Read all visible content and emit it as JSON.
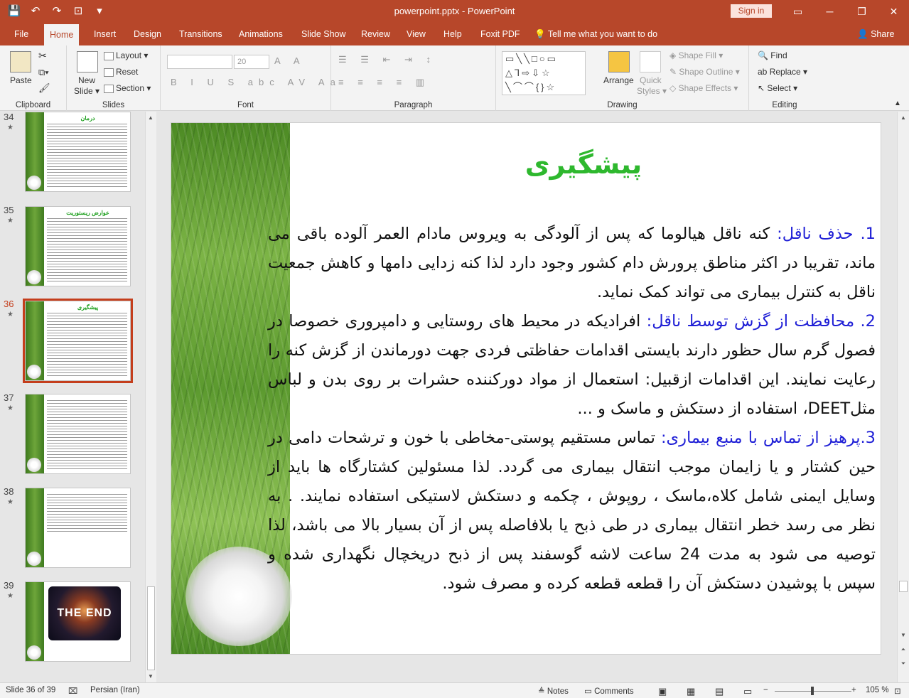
{
  "window": {
    "title": "powerpoint.pptx  -  PowerPoint",
    "signin": "Sign in",
    "minimize": "─",
    "restore": "❐",
    "close": "✕"
  },
  "qat": {
    "save": "💾",
    "undo": "↶",
    "redo": "↷",
    "present": "⊡",
    "more": "▾"
  },
  "tabs": [
    "File",
    "Home",
    "Insert",
    "Design",
    "Transitions",
    "Animations",
    "Slide Show",
    "Review",
    "View",
    "Help",
    "Foxit PDF"
  ],
  "tellme": "Tell me what you want to do",
  "share": "Share",
  "ribbon": {
    "clipboard": {
      "label": "Clipboard",
      "paste": "Paste"
    },
    "slides": {
      "label": "Slides",
      "new_slide_1": "New",
      "new_slide_2": "Slide ▾",
      "layout": "Layout ▾",
      "reset": "Reset",
      "section": "Section ▾"
    },
    "font": {
      "label": "Font",
      "size": "20",
      "styles": "B I U S abc AV Aa"
    },
    "paragraph": {
      "label": "Paragraph"
    },
    "drawing": {
      "label": "Drawing",
      "arrange": "Arrange",
      "quick_1": "Quick",
      "quick_2": "Styles ▾",
      "shape_fill": "Shape Fill ▾",
      "shape_outline": "Shape Outline ▾",
      "shape_effects": "Shape Effects ▾"
    },
    "editing": {
      "label": "Editing",
      "find": "Find",
      "replace": "Replace ▾",
      "select": "Select ▾"
    }
  },
  "thumbnails": [
    {
      "num": "34",
      "title": "درمان"
    },
    {
      "num": "35",
      "title": "عوارض ریستوریت"
    },
    {
      "num": "36",
      "title": "پیشگیری"
    },
    {
      "num": "37",
      "title": ""
    },
    {
      "num": "38",
      "title": ""
    },
    {
      "num": "39",
      "title": "",
      "end_text": "THE END"
    }
  ],
  "slide": {
    "title": "پیشگیری",
    "p1_head": "1. حذف ناقل:",
    "p1_text": " کنه ناقل هیالوما که پس از آلودگی به ویروس مادام العمر آلوده باقی می ماند، تقریبا در اکثر مناطق پرورش دام کشور وجود دارد لذا کنه زدایی دامها و کاهش جمعیت ناقل به کنترل بیماری می تواند کمک نماید.",
    "p2_head": "2. محافظت از گزش توسط ناقل:",
    "p2_text": " افرادیکه در محیط های روستایی و دامپروری خصوصا در فصول گرم سال حظور دارند بایستی اقدامات حفاظتی فردی جهت دورماندن از گزش کنه را رعایت نمایند. این اقدامات ازقبیل: استعمال از مواد دورکننده حشرات بر روی بدن و لباس مثلDEET، استفاده از دستکش و ماسک و ...",
    "p3_head": "3.پرهیز از تماس با منبع بیماری:",
    "p3_text": " تماس مستقیم پوستی-مخاطی با خون و ترشحات دامی در حین کشتار و یا زایمان موجب انتقال بیماری می گردد. لذا مسئولین کشتارگاه ها باید از وسایل ایمنی شامل کلاه،ماسک ، روپوش ، چکمه و دستکش لاستیکی استفاده نمایند. . به نظر می رسد خطر انتقال بیماری در طی ذبح یا بلافاصله پس از آن بسیار بالا می باشد، لذا توصیه می شود به مدت 24 ساعت لاشه گوسفند پس از ذبح دریخچال نگهداری شده و سپس با پوشیدن دستکش آن را قطعه قطعه کرده و مصرف شود."
  },
  "status": {
    "slide_of": "Slide 36 of 39",
    "language": "Persian (Iran)",
    "notes": "Notes",
    "comments": "Comments",
    "zoom": "105 %",
    "zoom_level_percent": 105
  }
}
